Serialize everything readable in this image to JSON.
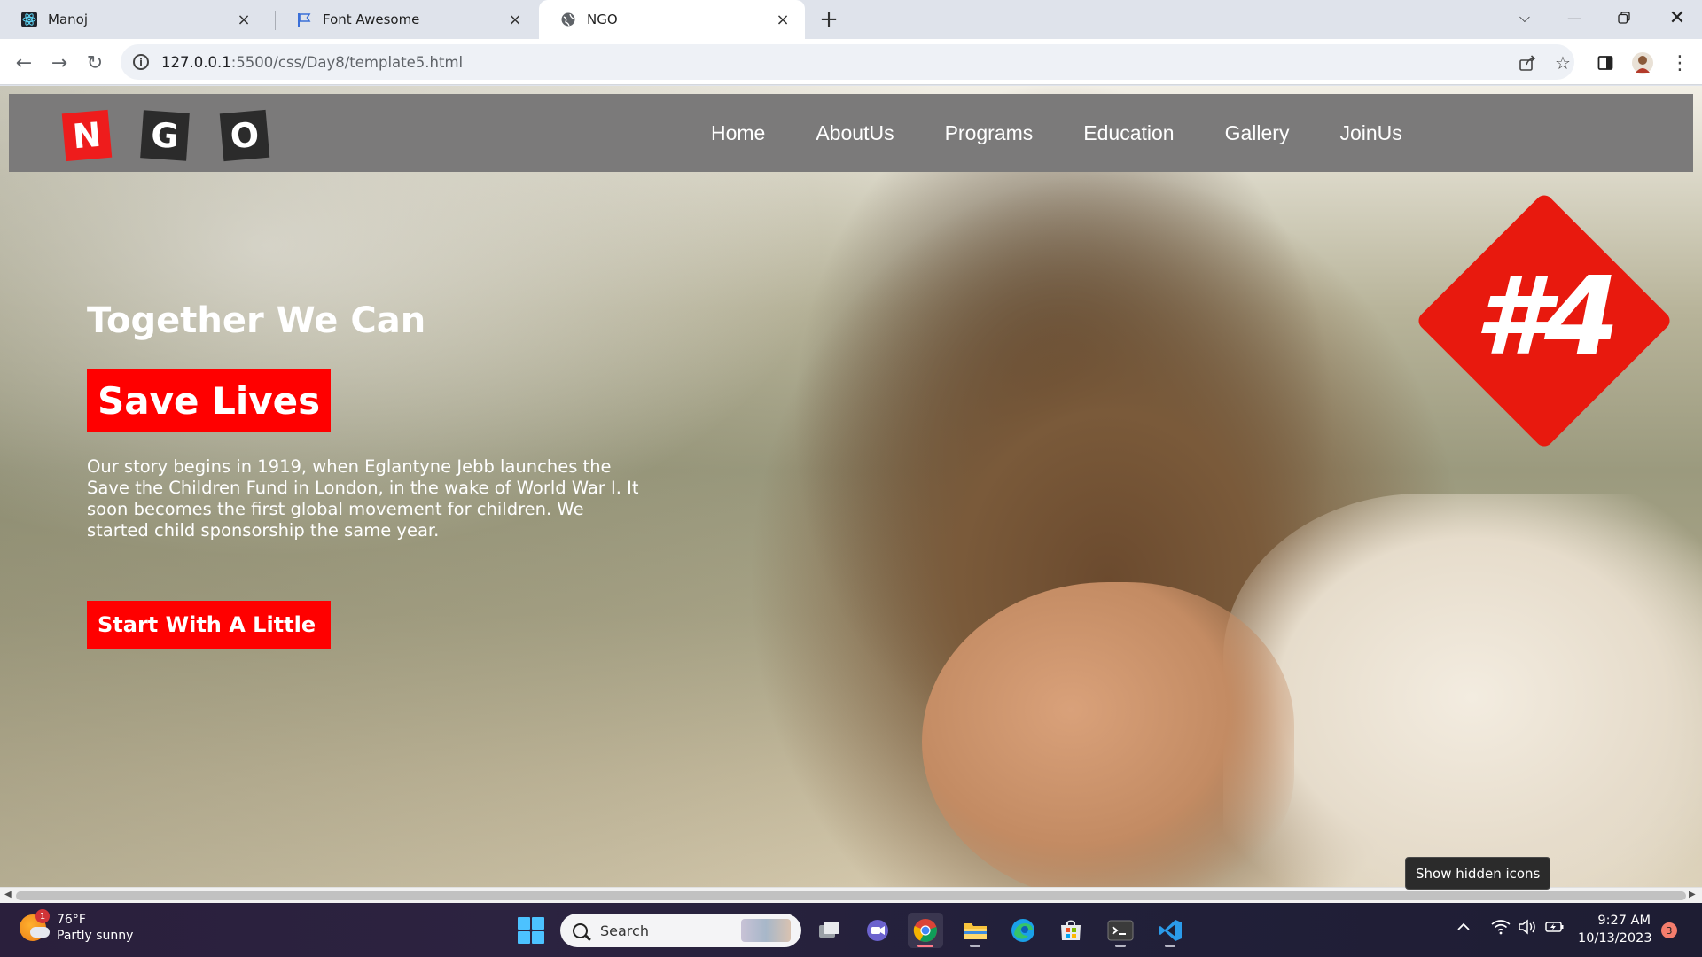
{
  "browser": {
    "tabs": [
      {
        "title": "Manoj",
        "icon": "react-icon"
      },
      {
        "title": "Font Awesome",
        "icon": "flag-icon"
      },
      {
        "title": "NGO",
        "icon": "globe-icon",
        "active": true
      }
    ],
    "url_host": "127.0.0.1",
    "url_rest": ":5500/css/Day8/template5.html"
  },
  "site": {
    "logo_letters": [
      "N",
      "G",
      "O"
    ],
    "menu": [
      "Home",
      "AboutUs",
      "Programs",
      "Education",
      "Gallery",
      "JoinUs"
    ],
    "hero": {
      "tagline": "Together We Can",
      "highlight": "Save Lives",
      "story": "Our story begins in 1919, when Eglantyne Jebb launches the Save the Children Fund in London, in the wake of World War I. It soon becomes the first global movement for children. We started child sponsorship the same year.",
      "cta": "Start With A Little",
      "badge": "#4"
    },
    "colors": {
      "nav_bg": "#7b7a7a",
      "accent_red": "#ff0000",
      "badge_red": "#e8190e"
    }
  },
  "tooltip": "Show hidden icons",
  "taskbar": {
    "weather_temp": "76°F",
    "weather_desc": "Partly sunny",
    "weather_badge": "1",
    "search_placeholder": "Search",
    "time": "9:27 AM",
    "date": "10/13/2023",
    "notifications": "3"
  }
}
